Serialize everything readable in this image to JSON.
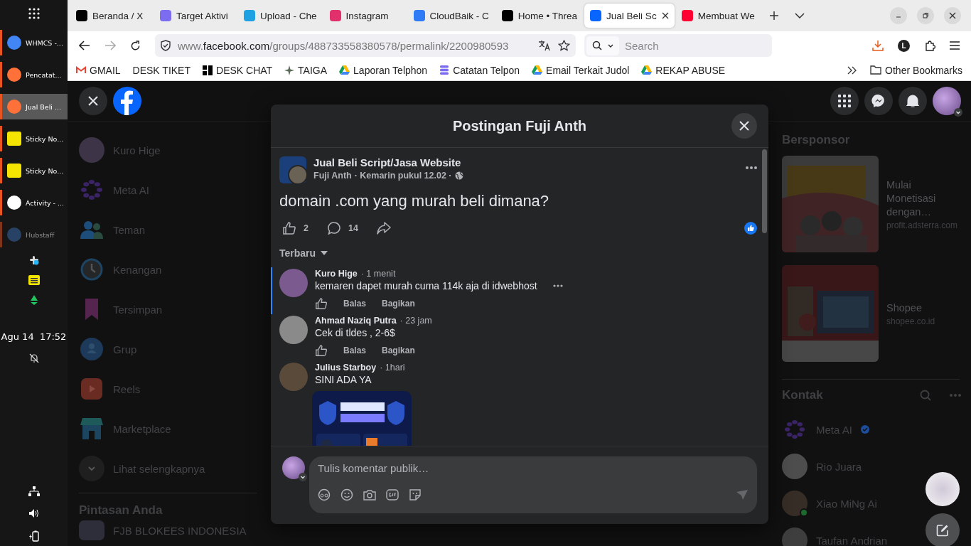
{
  "dock": {
    "items": [
      {
        "label": "WHMCS -...",
        "kind": "chrome",
        "selected": false
      },
      {
        "label": "Pencatat...",
        "kind": "firefox",
        "selected": false
      },
      {
        "label": "Jual Beli ...",
        "kind": "firefox",
        "selected": true
      },
      {
        "label": "Sticky No...",
        "kind": "sticky",
        "selected": false
      },
      {
        "label": "Sticky No...",
        "kind": "sticky",
        "selected": false
      },
      {
        "label": "Activity - ...",
        "kind": "slack",
        "selected": false
      },
      {
        "label": "Hubstaff",
        "kind": "hubstaff",
        "selected": false
      }
    ],
    "clock": {
      "date": "Agu 14",
      "time": "17:52"
    }
  },
  "tabs": [
    {
      "label": "Beranda / X",
      "selected": false
    },
    {
      "label": "Target Aktivi",
      "selected": false
    },
    {
      "label": "Upload - Che",
      "selected": false
    },
    {
      "label": "Instagram",
      "selected": false
    },
    {
      "label": "CloudBaik - C",
      "selected": false
    },
    {
      "label": "Home • Threa",
      "selected": false
    },
    {
      "label": "Jual Beli Sc",
      "selected": true
    },
    {
      "label": "Membuat We",
      "selected": false
    }
  ],
  "address": {
    "prefix": "www.",
    "domain": "facebook.com",
    "path": "/groups/488733558380578/permalink/2200980593"
  },
  "search": {
    "placeholder": "Search"
  },
  "profile_initial": "L",
  "bookmarks": [
    {
      "label": "GMAIL"
    },
    {
      "label": "DESK TIKET"
    },
    {
      "label": "DESK CHAT"
    },
    {
      "label": "TAIGA"
    },
    {
      "label": "Laporan Telphon"
    },
    {
      "label": "Catatan Telpon"
    },
    {
      "label": "Email Terkait Judol"
    },
    {
      "label": "REKAP ABUSE"
    }
  ],
  "other_bookmarks": "Other Bookmarks",
  "sidebar": {
    "items": [
      {
        "label": "Kuro Hige",
        "kind": "avatar"
      },
      {
        "label": "Meta AI",
        "kind": "meta-ai"
      },
      {
        "label": "Teman",
        "kind": "friends"
      },
      {
        "label": "Kenangan",
        "kind": "memories"
      },
      {
        "label": "Tersimpan",
        "kind": "saved"
      },
      {
        "label": "Grup",
        "kind": "groups"
      },
      {
        "label": "Reels",
        "kind": "reels"
      },
      {
        "label": "Marketplace",
        "kind": "marketplace"
      },
      {
        "label": "Lihat selengkapnya",
        "kind": "more"
      }
    ],
    "shortcuts_title": "Pintasan Anda",
    "shortcuts": [
      {
        "label": "FJB BLOKEES INDONESIA"
      }
    ]
  },
  "sponsored": {
    "title": "Bersponsor",
    "ads": [
      {
        "title": "Mulai Monetisasi dengan…",
        "domain": "profit.adsterra.com",
        "kind": "picture"
      },
      {
        "title": "Shopee",
        "domain": "shopee.co.id",
        "kind": "picture"
      }
    ]
  },
  "contacts": {
    "title": "Kontak",
    "items": [
      {
        "name": "Meta AI",
        "kind": "meta-ai",
        "verified": true,
        "online": false
      },
      {
        "name": "Rio Juara",
        "kind": "avatar",
        "verified": false,
        "online": false
      },
      {
        "name": "Xiao MiNg Ai",
        "kind": "avatar",
        "verified": false,
        "online": true
      },
      {
        "name": "Taufan Andrian",
        "kind": "avatar",
        "verified": false,
        "online": false
      }
    ]
  },
  "modal": {
    "title": "Postingan Fuji Anth",
    "post": {
      "group": "Jual Beli Script/Jasa Website",
      "author": "Fuji Anth",
      "time": "· Kemarin pukul 12.02 ·",
      "text": "domain .com yang murah beli dimana?",
      "likes": "2",
      "comments": "14",
      "liked": true
    },
    "sort": "Terbaru",
    "comments": [
      {
        "author": "Kuro Hige",
        "time": "· 1 menit",
        "text": "kemaren dapet murah cuma 114k aja di idwebhost",
        "selected": true,
        "actions": [
          "Balas",
          "Bagikan"
        ]
      },
      {
        "author": "Ahmad Naziq Putra",
        "time": "· 23 jam",
        "text": "Cek di tldes , 2-6$",
        "selected": false,
        "actions": [
          "Balas",
          "Bagikan"
        ]
      },
      {
        "author": "Julius Starboy",
        "time": "· 1hari",
        "text": "SINI ADA YA",
        "selected": false
      }
    ],
    "composer": {
      "placeholder": "Tulis komentar publik…"
    }
  }
}
